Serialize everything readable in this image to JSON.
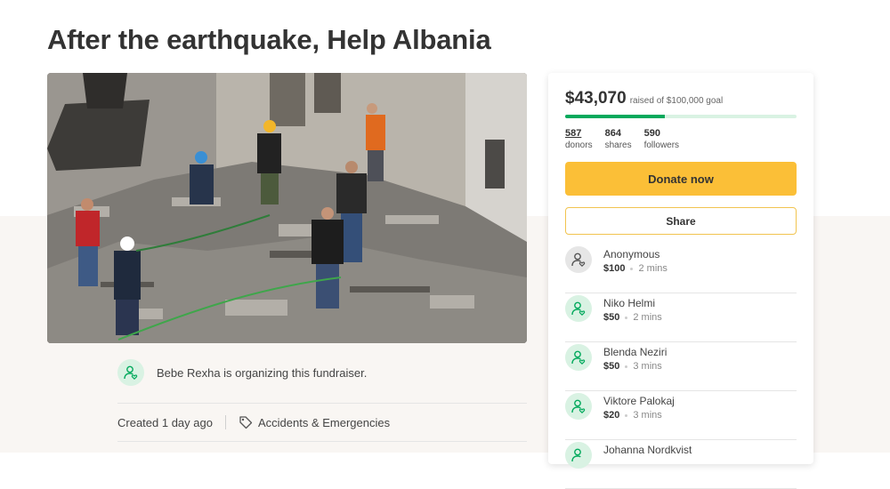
{
  "campaign": {
    "title": "After the earthquake, Help Albania",
    "organizer_text": "Bebe Rexha is organizing this fundraiser.",
    "created": "Created 1 day ago",
    "category": "Accidents & Emergencies"
  },
  "summary": {
    "raised": "$43,070",
    "goal_text": "raised of $100,000 goal",
    "progress_fraction": 0.4307,
    "donors_count": "587",
    "donors_label": "donors",
    "shares_count": "864",
    "shares_label": "shares",
    "followers_count": "590",
    "followers_label": "followers"
  },
  "actions": {
    "donate_label": "Donate now",
    "share_label": "Share"
  },
  "donations": [
    {
      "name": "Anonymous",
      "amount": "$100",
      "time": "2 mins"
    },
    {
      "name": "Niko Helmi",
      "amount": "$50",
      "time": "2 mins"
    },
    {
      "name": "Blenda Neziri",
      "amount": "$50",
      "time": "3 mins"
    },
    {
      "name": "Viktore Palokaj",
      "amount": "$20",
      "time": "3 mins"
    },
    {
      "name": "Johanna Nordkvist",
      "amount": "",
      "time": ""
    }
  ],
  "colors": {
    "brand_green": "#02a95c",
    "donate_yellow": "#fbbf37",
    "avatar_green_bg": "#d9f2e3"
  }
}
